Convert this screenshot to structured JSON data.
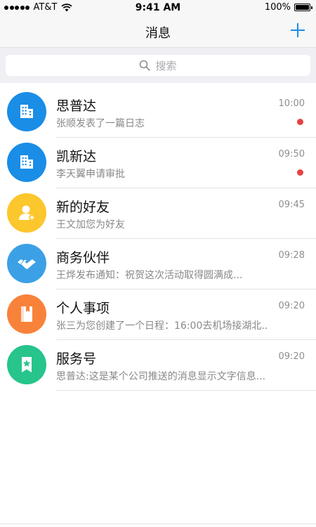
{
  "status_bar": {
    "carrier": "AT&T",
    "time": "9:41 AM",
    "battery": "100%"
  },
  "nav": {
    "title": "消息"
  },
  "search": {
    "placeholder": "搜索"
  },
  "colors": {
    "accent": "#1a8de6",
    "unread": "#e64340"
  },
  "conversations": [
    {
      "title": "思普达",
      "preview": "张顺发表了一篇日志",
      "time": "10:00",
      "unread": true,
      "icon": "building-icon",
      "color": "#1a8de6"
    },
    {
      "title": "凯新达",
      "preview": "李天翼申请审批",
      "time": "09:50",
      "unread": true,
      "icon": "building-icon",
      "color": "#1a8de6"
    },
    {
      "title": "新的好友",
      "preview": "王文加您为好友",
      "time": "09:45",
      "unread": false,
      "icon": "add-friend-icon",
      "color": "#fcc62d"
    },
    {
      "title": "商务伙伴",
      "preview": "王烨发布通知：祝贺这次活动取得圆满成...",
      "time": "09:28",
      "unread": false,
      "icon": "handshake-icon",
      "color": "#3ca0e6"
    },
    {
      "title": "个人事项",
      "preview": "张三为您创建了一个日程：16:00去机场接湖北...",
      "time": "09:20",
      "unread": false,
      "icon": "notebook-icon",
      "color": "#f8823a"
    },
    {
      "title": "服务号",
      "preview": "思普达:这是某个公司推送的消息显示文字信息...",
      "time": "09:20",
      "unread": false,
      "icon": "star-badge-icon",
      "color": "#27c48c"
    }
  ]
}
